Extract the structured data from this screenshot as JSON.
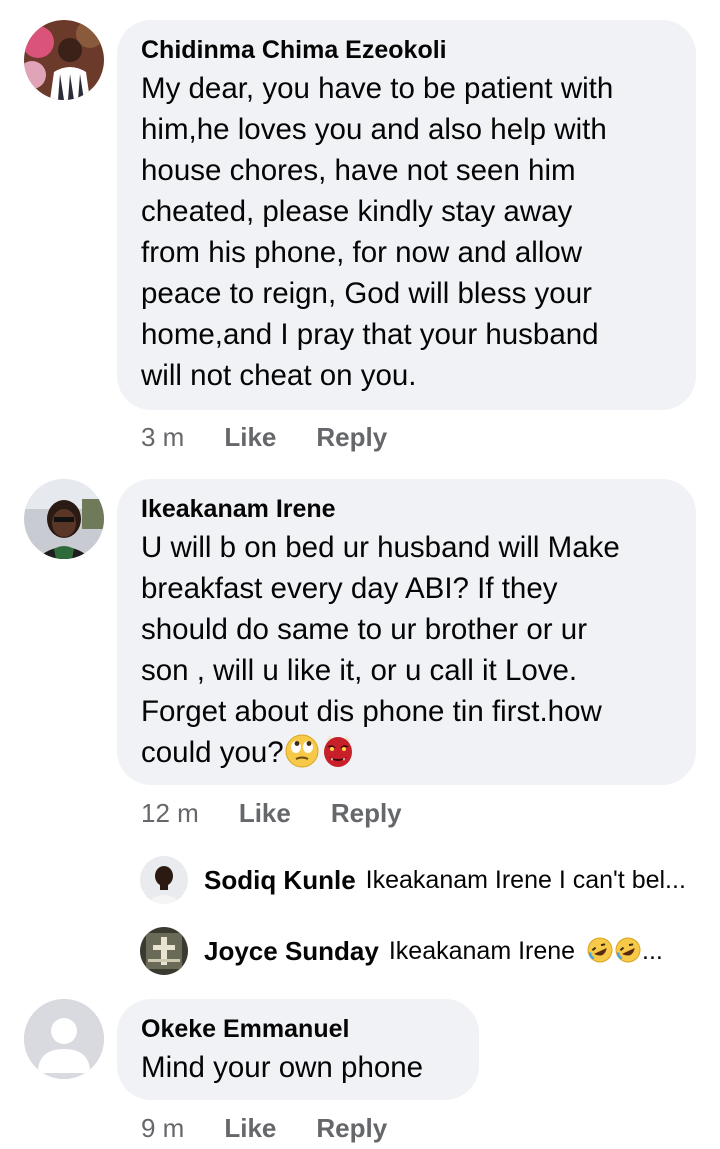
{
  "comments": [
    {
      "author": "Chidinma Chima Ezeokoli",
      "text_lines": [
        "My dear, you have to be patient with",
        "him,he loves you and also help with",
        "house chores, have not seen him",
        "cheated, please kindly stay away",
        "from his phone, for now and allow",
        "peace to reign, God will bless your",
        "home,and I pray that your husband",
        "will not cheat on you."
      ],
      "time": "3 m",
      "like": "Like",
      "reply": "Reply"
    },
    {
      "author": "Ikeakanam Irene",
      "text_lines": [
        "U will b on bed ur husband will Make",
        "breakfast every day ABI? If they",
        "should do same to ur brother or ur",
        "son , will u like it, or u call it Love.",
        "Forget about dis phone tin first.how",
        "could you?"
      ],
      "emojis": [
        "face-with-rolling-eyes-icon",
        "ogre-icon"
      ],
      "time": "12 m",
      "like": "Like",
      "reply": "Reply",
      "replies": [
        {
          "author": "Sodiq Kunle",
          "preview": "Ikeakanam Irene I can't bel..."
        },
        {
          "author": "Joyce Sunday",
          "preview": "Ikeakanam Irene",
          "preview_suffix": "...",
          "emojis": [
            "rolling-on-floor-laughing-icon",
            "rolling-on-floor-laughing-icon"
          ]
        }
      ]
    },
    {
      "author": "Okeke Emmanuel",
      "text_lines": [
        "Mind your own phone"
      ],
      "time": "9 m",
      "like": "Like",
      "reply": "Reply"
    }
  ],
  "colors": {
    "bubble_bg": "#f0f2f5",
    "meta_text": "#65676b",
    "primary_text": "#050505",
    "default_avatar_bg": "#d8dadf"
  }
}
